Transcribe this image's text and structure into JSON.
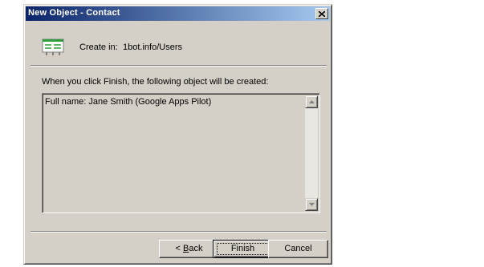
{
  "window": {
    "title": "New Object - Contact"
  },
  "create_in": {
    "label": "Create in:",
    "path": "1bot.info/Users"
  },
  "description": "When you click Finish, the following object will be created:",
  "summary": {
    "text": "Full name: Jane Smith (Google Apps Pilot)"
  },
  "buttons": {
    "back_prefix": "< ",
    "back_mnemonic": "B",
    "back_rest": "ack",
    "finish": "Finish",
    "cancel": "Cancel"
  },
  "icons": {
    "close": "close-icon",
    "contact": "contact-card-icon",
    "scroll_up": "scroll-up-arrow-icon",
    "scroll_down": "scroll-down-arrow-icon"
  },
  "colors": {
    "titlebar_start": "#0a246a",
    "titlebar_end": "#a6caf0",
    "face": "#d4d0c8",
    "icon_green": "#2e9e3e"
  }
}
